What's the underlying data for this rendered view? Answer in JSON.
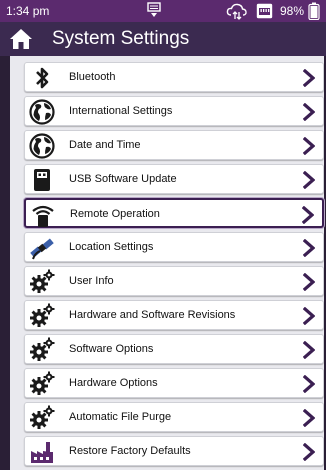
{
  "status": {
    "time": "1:34 pm",
    "battery": "98%"
  },
  "header": {
    "title": "System Settings"
  },
  "settings": {
    "items": [
      {
        "label": "Bluetooth",
        "icon": "bluetooth-icon"
      },
      {
        "label": "International Settings",
        "icon": "globe-icon"
      },
      {
        "label": "Date and Time",
        "icon": "globe-icon"
      },
      {
        "label": "USB Software Update",
        "icon": "usb-drive-icon"
      },
      {
        "label": "Remote Operation",
        "icon": "remote-antenna-icon",
        "selected": true
      },
      {
        "label": "Location Settings",
        "icon": "satellite-icon"
      },
      {
        "label": "User Info",
        "icon": "gears-icon"
      },
      {
        "label": "Hardware and Software Revisions",
        "icon": "gears-icon"
      },
      {
        "label": "Software Options",
        "icon": "gears-icon"
      },
      {
        "label": "Hardware Options",
        "icon": "gears-icon"
      },
      {
        "label": "Automatic File Purge",
        "icon": "gears-icon"
      },
      {
        "label": "Restore Factory Defaults",
        "icon": "factory-icon"
      }
    ]
  },
  "colors": {
    "status_bar": "#5b2a6e",
    "title_bar": "#3b2a50",
    "chevron": "#3b1f52",
    "list_bg": "#e9e9ee"
  }
}
